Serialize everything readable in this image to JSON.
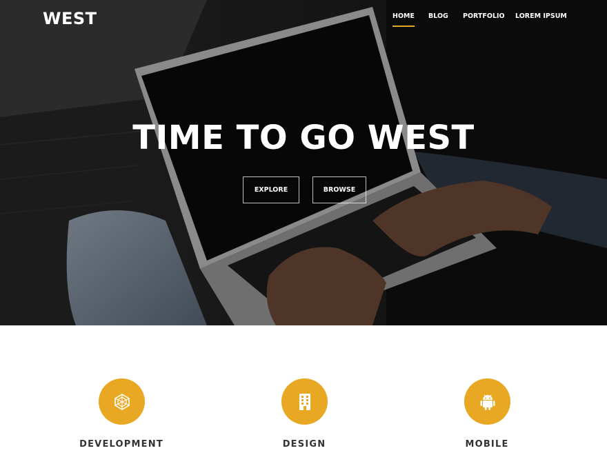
{
  "brand": {
    "name": "WEST"
  },
  "nav": {
    "items": [
      {
        "label": "HOME",
        "active": true
      },
      {
        "label": "BLOG",
        "active": false
      },
      {
        "label": "PORTFOLIO",
        "active": false
      },
      {
        "label": "LOREM IPSUM",
        "active": false
      }
    ]
  },
  "hero": {
    "title": "TIME TO GO WEST",
    "buttons": [
      {
        "label": "EXPLORE"
      },
      {
        "label": "BROWSE"
      }
    ],
    "image": "laptop-typing-photo"
  },
  "features": [
    {
      "label": "DEVELOPMENT",
      "icon": "geodesic-icon"
    },
    {
      "label": "DESIGN",
      "icon": "building-icon"
    },
    {
      "label": "MOBILE",
      "icon": "android-icon"
    }
  ],
  "colors": {
    "accent": "#e8a823",
    "hero_bg": "#141414",
    "feature_text": "#333333"
  }
}
